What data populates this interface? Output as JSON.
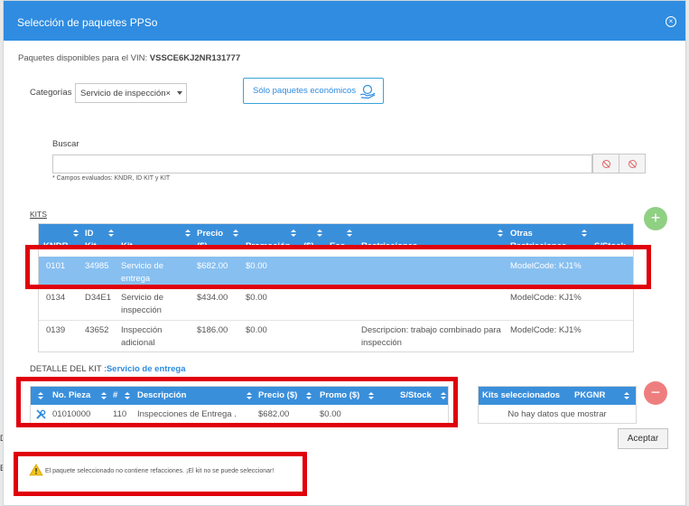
{
  "modal": {
    "title": "Selección de paquetes PPSo",
    "close_glyph": "×",
    "vin_label": "Paquetes disponibles para el VIN:",
    "vin": "VSSCE6KJ2NR131777",
    "category_label": "Categorías",
    "category_value": "Servicio de inspección×",
    "eco_button": "Sólo paquetes económicos",
    "search_label": "Buscar",
    "search_value": "",
    "search_hint": "* Campos evaluados: KNDR, ID KIT y KIT",
    "kits_label": "KITS",
    "plus": "+",
    "minus": "−",
    "detail_label": "DETALLE DEL KIT :",
    "detail_kit": "Servicio de entrega",
    "accept": "Aceptar",
    "warning": "El paquete seleccionado no contiene refacciones. ¡El kit no se puede seleccionar!"
  },
  "kits_table": {
    "headers": [
      "KNDR",
      "ID Kit",
      "Kit",
      "Precio ($)",
      "Promoción",
      "($)",
      "Eco",
      "Restricciones",
      "Otras Restricciones",
      "S/Stock"
    ],
    "rows": [
      {
        "kndr": "0101",
        "id": "34985",
        "kit": "Servicio de entrega",
        "precio": "$682.00",
        "promo": "$0.00",
        "restr": "",
        "otras": "ModelCode: KJ1%",
        "selected": true
      },
      {
        "kndr": "0134",
        "id": "D34E1",
        "kit": "Servicio de inspección",
        "precio": "$434.00",
        "promo": "$0.00",
        "restr": "",
        "otras": "ModelCode: KJ1%",
        "selected": false
      },
      {
        "kndr": "0139",
        "id": "43652",
        "kit": "Inspección adicional",
        "precio": "$186.00",
        "promo": "$0.00",
        "restr": "Descripcion: trabajo combinado para inspección",
        "otras": "ModelCode: KJ1%",
        "selected": false
      }
    ]
  },
  "detail_table": {
    "headers": [
      "No. Pieza",
      "#",
      "Descripción",
      "Precio ($)",
      "Promo ($)",
      "S/Stock"
    ],
    "row": {
      "pieza": "01010000",
      "num": "110",
      "desc": "Inspecciones de Entrega .",
      "precio": "$682.00",
      "promo": "$0.00",
      "stock": ""
    }
  },
  "selected_table": {
    "headers": [
      "Kits seleccionados",
      "PKGNR"
    ],
    "empty": "No hay datos que mostrar"
  },
  "edge_fragments": [
    "D",
    "E"
  ],
  "colors": {
    "header": "#2f8ce0",
    "table_header": "#3a8fdb",
    "selected_row": "#87bff0",
    "highlight": "#e0000b",
    "plus": "#8fd083",
    "minus": "#ee7e7e"
  },
  "icons": {
    "close": "close-icon",
    "eco": "money-hand-icon",
    "clear": "clear-icon",
    "apply": "apply-icon",
    "wrench": "wrench-icon",
    "warning": "warning-icon"
  }
}
